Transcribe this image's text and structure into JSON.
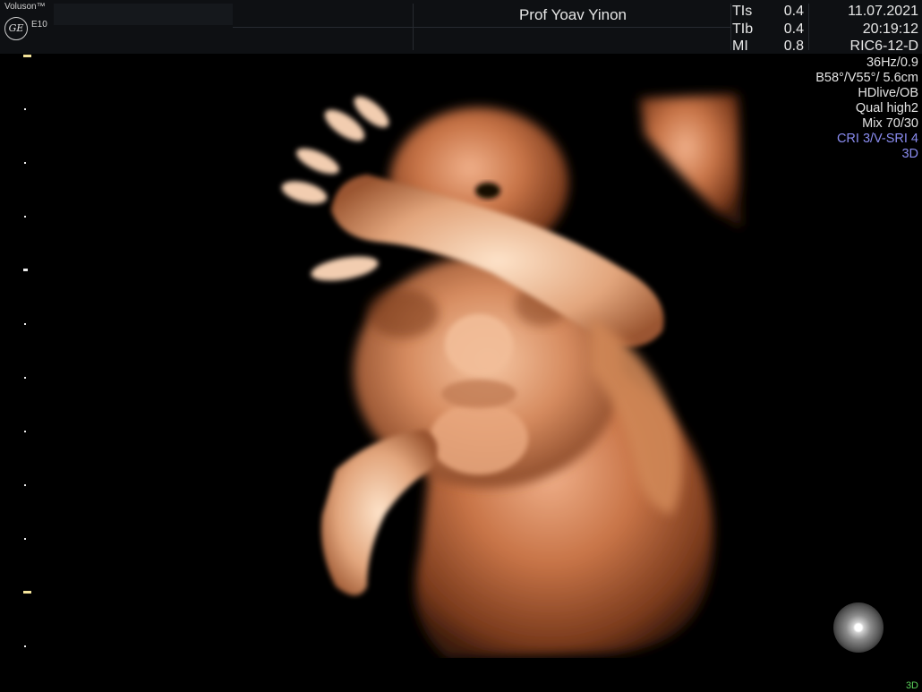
{
  "header": {
    "brand": "Voluson™",
    "model": "E10",
    "logo_text": "GE",
    "operator": "Prof Yoav Yinon",
    "indices": [
      {
        "label": "TIs",
        "value": "0.4"
      },
      {
        "label": "TIb",
        "value": "0.4"
      },
      {
        "label": "MI",
        "value": "0.8"
      }
    ],
    "date": "11.07.2021",
    "time": "20:19:12",
    "probe": "RIC6-12-D"
  },
  "params": {
    "frame_rate": "36Hz/0.9",
    "angles": "B58°/V55°/ 5.6cm",
    "render": "HDlive/OB",
    "quality": "Qual high2",
    "mix": "Mix 70/30",
    "cri": "CRI 3/V-SRI 4",
    "mode": "3D"
  },
  "footer": {
    "mode": "3D"
  },
  "colors": {
    "accent_blue": "#8a8cf0",
    "mode_green": "#5cd35c",
    "skin": "#c8734a"
  }
}
